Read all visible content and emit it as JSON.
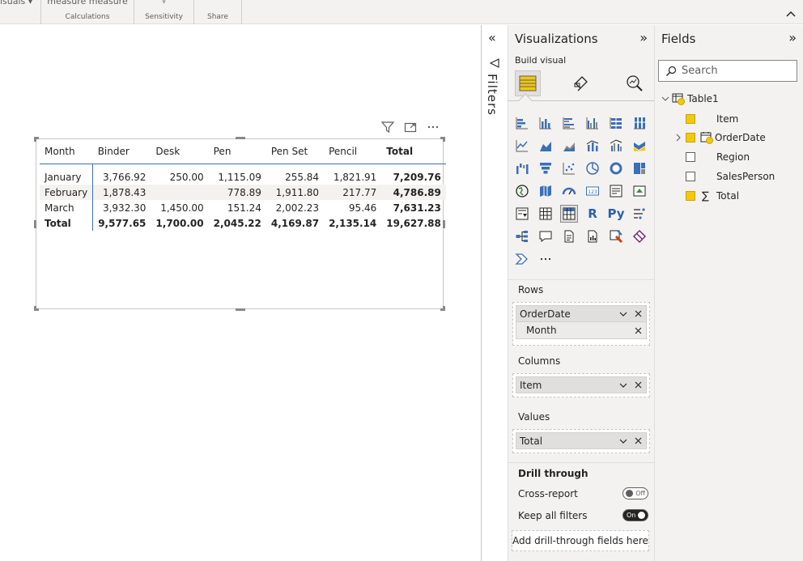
{
  "ribbon": {
    "groups": [
      {
        "top": "isuals ▾",
        "label": ""
      },
      {
        "top": "measure measure",
        "label": "Calculations"
      },
      {
        "top": "",
        "label": "Sensitivity"
      },
      {
        "top": "",
        "label": "Share"
      }
    ]
  },
  "matrix": {
    "headers": [
      "Month",
      "Binder",
      "Desk",
      "Pen",
      "Pen Set",
      "Pencil",
      "Total"
    ],
    "rows": [
      [
        "January",
        "3,766.92",
        "250.00",
        "1,115.09",
        "255.84",
        "1,821.91",
        "7,209.76"
      ],
      [
        "February",
        "1,878.43",
        "",
        "778.89",
        "1,911.80",
        "217.77",
        "4,786.89"
      ],
      [
        "March",
        "3,932.30",
        "1,450.00",
        "151.24",
        "2,002.23",
        "95.46",
        "7,631.23"
      ],
      [
        "Total",
        "9,577.65",
        "1,700.00",
        "2,045.22",
        "4,169.87",
        "2,135.14",
        "19,627.88"
      ]
    ]
  },
  "filters": {
    "label": "Filters"
  },
  "visualizations": {
    "title": "Visualizations",
    "build_label": "Build visual",
    "wells": {
      "rows": {
        "title": "Rows",
        "field": "OrderDate",
        "sub": "Month"
      },
      "columns": {
        "title": "Columns",
        "field": "Item"
      },
      "values": {
        "title": "Values",
        "field": "Total"
      }
    },
    "drill": {
      "title": "Drill through",
      "cross_report": "Cross-report",
      "cross_report_state": "Off",
      "keep_filters": "Keep all filters",
      "keep_filters_state": "On",
      "add_label": "Add drill-through fields here"
    },
    "icon_text": {
      "r": "R",
      "py": "Py"
    }
  },
  "fields": {
    "title": "Fields",
    "search_placeholder": "Search",
    "table": "Table1",
    "items": [
      {
        "label": "Item",
        "checked": true
      },
      {
        "label": "OrderDate",
        "checked": true
      },
      {
        "label": "Region",
        "checked": false
      },
      {
        "label": "SalesPerson",
        "checked": false
      },
      {
        "label": "Total",
        "checked": true
      }
    ]
  },
  "colors": {
    "accent": "#f2c811",
    "matrix_line": "#3b6fb6",
    "pane_bg": "#f3f2f1"
  }
}
